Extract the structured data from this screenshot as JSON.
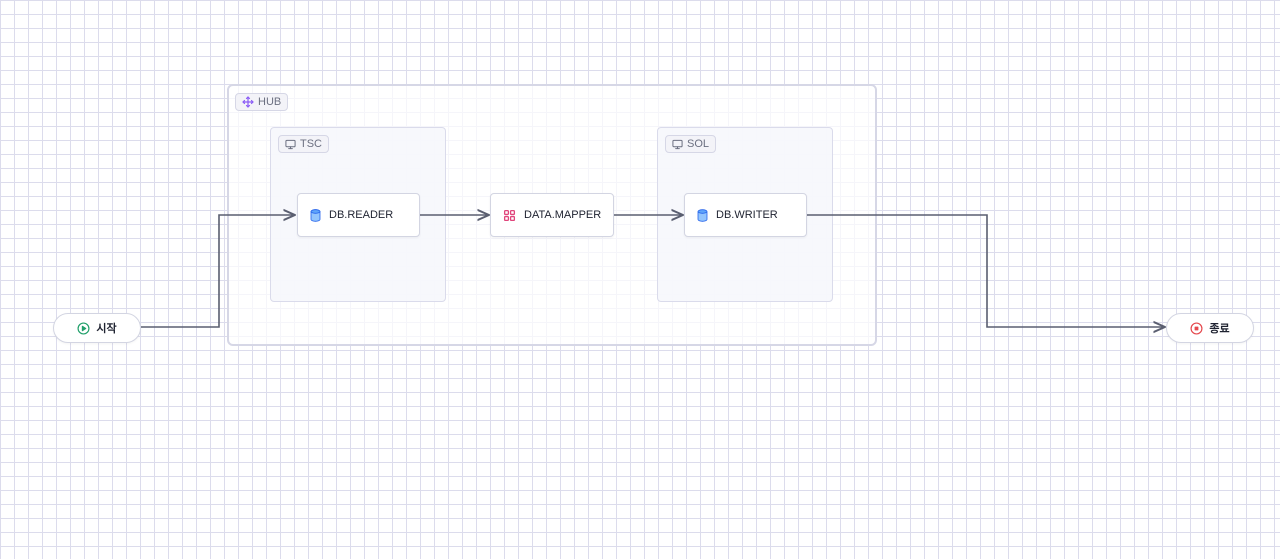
{
  "canvas": {
    "groups": {
      "hub": {
        "label": "HUB",
        "icon": "move-icon"
      },
      "tsc": {
        "label": "TSC",
        "icon": "monitor-icon"
      },
      "sol": {
        "label": "SOL",
        "icon": "monitor-icon"
      }
    },
    "nodes": {
      "start": {
        "label": "시작",
        "icon": "play-circle-icon",
        "color": "#22a06b"
      },
      "db_reader": {
        "label": "DB.READER",
        "icon": "database-icon",
        "color": "#3b82f6"
      },
      "data_mapper": {
        "label": "DATA.MAPPER",
        "icon": "grid-icon",
        "color": "#e0457b"
      },
      "db_writer": {
        "label": "DB.WRITER",
        "icon": "database-icon",
        "color": "#3b82f6"
      },
      "end": {
        "label": "종료",
        "icon": "stop-circle-icon",
        "color": "#e5484d"
      }
    },
    "colors": {
      "edge": "#5a5e70",
      "grid": "#dcdcec",
      "group_tag_icon": "#8b5cf6"
    }
  }
}
